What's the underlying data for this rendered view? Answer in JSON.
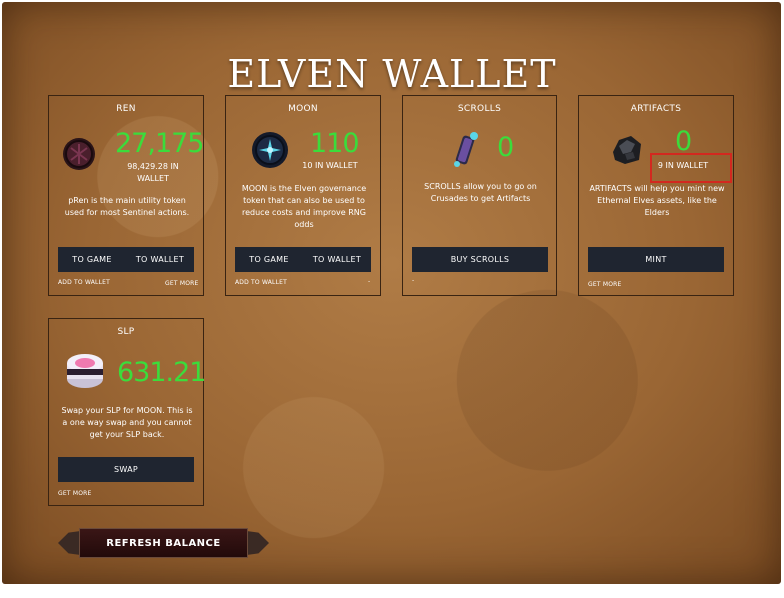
{
  "title": "ELVEN WALLET",
  "colors": {
    "accent_green": "#3bdc3b",
    "button_bg": "#1f2530",
    "highlight_border": "#d3281f"
  },
  "cards": {
    "ren": {
      "title": "REN",
      "amount": "27,175",
      "sub_line1": "98,429.28 IN",
      "sub_line2": "WALLET",
      "description": "pRen is the main utility token used for most Sentinel actions.",
      "buttons": [
        "TO GAME",
        "TO WALLET"
      ],
      "link_left": "ADD TO WALLET",
      "link_right": "GET MORE",
      "icon": "ren-token-icon"
    },
    "moon": {
      "title": "MOON",
      "amount": "110",
      "sub": "10 IN WALLET",
      "description": "MOON is the Elven governance token that can also be used to reduce costs and improve RNG odds",
      "buttons": [
        "TO GAME",
        "TO WALLET"
      ],
      "link_left": "ADD TO WALLET",
      "link_right": "-",
      "icon": "moon-token-icon"
    },
    "scrolls": {
      "title": "SCROLLS",
      "amount": "0",
      "description": "SCROLLS allow you to go on Crusades to get Artifacts",
      "buttons": [
        "BUY SCROLLS"
      ],
      "link_left": "-",
      "icon": "scroll-icon"
    },
    "artifacts": {
      "title": "ARTIFACTS",
      "amount": "0",
      "sub": "9 IN WALLET",
      "description": "ARTIFACTS will help you mint new Ethernal Elves assets, like the Elders",
      "buttons": [
        "MINT"
      ],
      "link_left": "GET MORE",
      "icon": "artifact-rock-icon"
    },
    "slp": {
      "title": "SLP",
      "amount": "631.21",
      "description": "Swap your SLP for MOON. This is a one way swap and you cannot get your SLP back.",
      "buttons": [
        "SWAP"
      ],
      "link_left": "GET MORE",
      "icon": "slp-potion-icon"
    }
  },
  "refresh_label": "REFRESH BALANCE"
}
